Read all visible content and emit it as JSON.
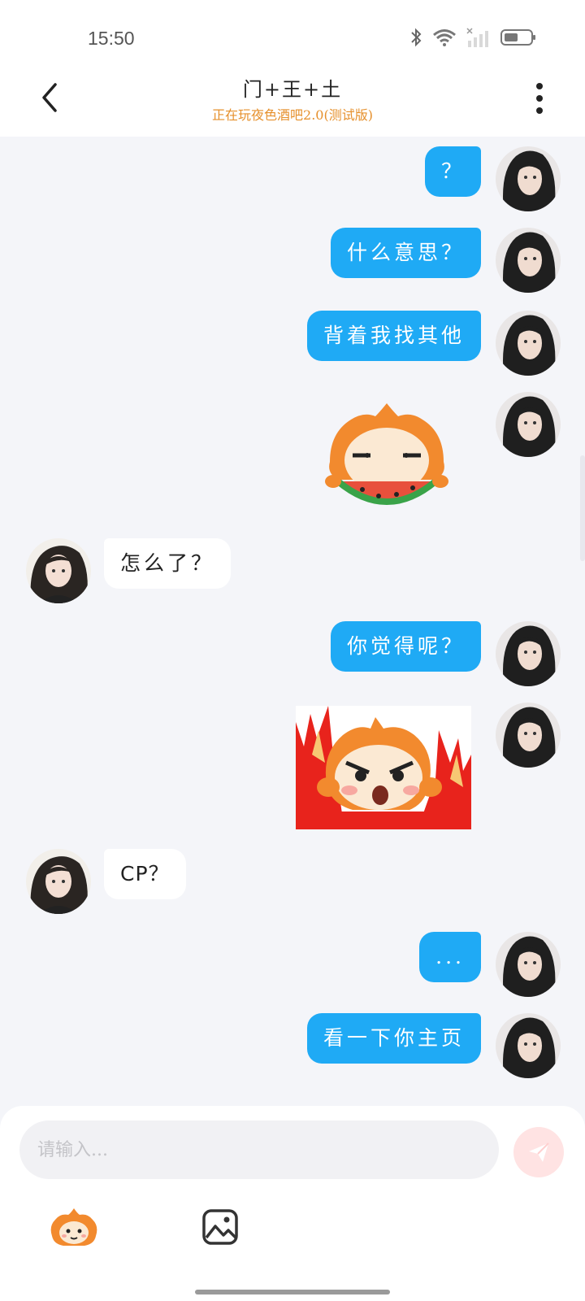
{
  "status_bar": {
    "time": "15:50",
    "icons": [
      "bluetooth-icon",
      "wifi-icon",
      "signal-icon",
      "battery-icon"
    ]
  },
  "header": {
    "title": "门+王+土",
    "subtitle": "正在玩夜色酒吧2.0(测试版)",
    "subtitle_color": "#e6902c",
    "icons": [
      "back-arrow-icon",
      "more-dots-icon"
    ]
  },
  "colors": {
    "outgoing_bubble": "#1faaf5",
    "incoming_bubble": "#ffffff",
    "background": "#f4f5f9"
  },
  "messages": [
    {
      "side": "me",
      "type": "text",
      "text": "？"
    },
    {
      "side": "me",
      "type": "text",
      "text": "什么意思？"
    },
    {
      "side": "me",
      "type": "text",
      "text": "背着我找其他"
    },
    {
      "side": "me",
      "type": "sticker",
      "sticker": "monkey-eating-watermelon-sticker"
    },
    {
      "side": "peer",
      "type": "text",
      "text": "怎么了？"
    },
    {
      "side": "me",
      "type": "text",
      "text": "你觉得呢？"
    },
    {
      "side": "me",
      "type": "sticker",
      "sticker": "angry-monkey-fire-sticker"
    },
    {
      "side": "peer",
      "type": "text",
      "text": "CP？"
    },
    {
      "side": "me",
      "type": "text",
      "text": "..."
    },
    {
      "side": "me",
      "type": "text",
      "text": "看一下你主页"
    }
  ],
  "composer": {
    "placeholder": "请输入...",
    "value": "",
    "icons": [
      "send-icon",
      "emoji-sticker-icon",
      "image-icon"
    ]
  }
}
